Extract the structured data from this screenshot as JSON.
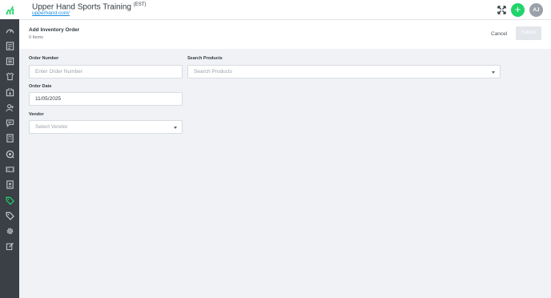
{
  "header": {
    "business_name": "Upper Hand Sports Training",
    "timezone": "(EST)",
    "url": "upperhand.com/",
    "add_button": "+",
    "avatar_initials": "AJ"
  },
  "page": {
    "title": "Add Inventory Order",
    "item_count": "0 Items",
    "cancel_label": "Cancel",
    "submit_label": "Submit"
  },
  "form": {
    "order_number": {
      "label": "Order Number",
      "placeholder": "Enter Order Number"
    },
    "search_products": {
      "label": "Search Products",
      "placeholder": "Search Products"
    },
    "order_date": {
      "label": "Order Date",
      "value": "11/05/2025"
    },
    "vendor": {
      "label": "Vendor",
      "placeholder": "Select Vendor"
    }
  },
  "sidebar": {
    "items": [
      {
        "icon": "dashboard-icon"
      },
      {
        "icon": "calendar-icon"
      },
      {
        "icon": "events-icon"
      },
      {
        "icon": "staff-icon"
      },
      {
        "icon": "reports-icon"
      },
      {
        "icon": "clients-icon"
      },
      {
        "icon": "messages-icon"
      },
      {
        "icon": "accounting-icon"
      },
      {
        "icon": "memberships-icon"
      },
      {
        "icon": "credit-passes-icon"
      },
      {
        "icon": "contracts-icon"
      },
      {
        "icon": "inventory-icon",
        "active": true
      },
      {
        "icon": "coupons-icon"
      },
      {
        "icon": "settings-icon"
      },
      {
        "icon": "marketing-icon"
      }
    ]
  },
  "colors": {
    "sidebar_bg": "#3b3f46",
    "sidebar_icon": "#c6cad0",
    "active_accent": "#21d46a",
    "link": "#1a8fe3",
    "background": "#f0f2f5"
  }
}
